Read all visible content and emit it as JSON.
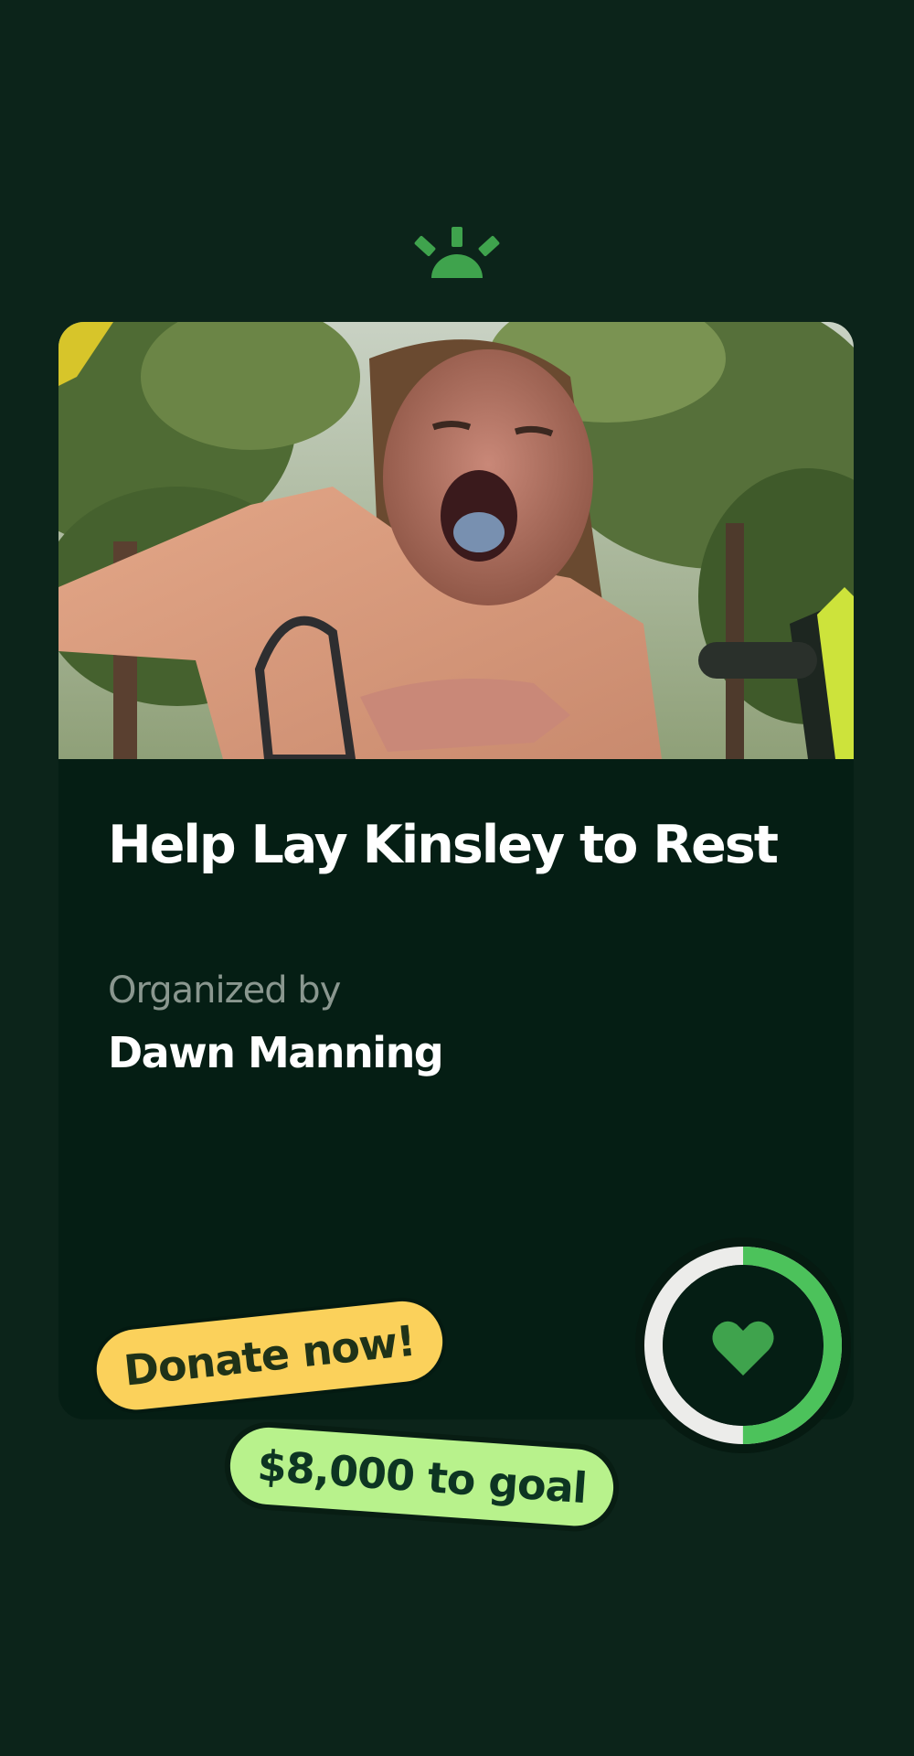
{
  "campaign": {
    "title": "Help Lay Kinsley to Rest",
    "organized_label": "Organized by",
    "organizer_name": "Dawn Manning",
    "photo": "campaign-photo-girl-laughing-in-forest"
  },
  "progress": {
    "fraction_raised": 0.5,
    "icon": "heart-icon"
  },
  "tags": {
    "donate_label": "Donate now!",
    "goal_label": "$8,000 to goal"
  },
  "colors": {
    "background": "#0c241a",
    "card": "#051e14",
    "brand_green": "#3fa34d",
    "donate_tag": "#fbd15b",
    "goal_tag": "#b8f28c"
  }
}
